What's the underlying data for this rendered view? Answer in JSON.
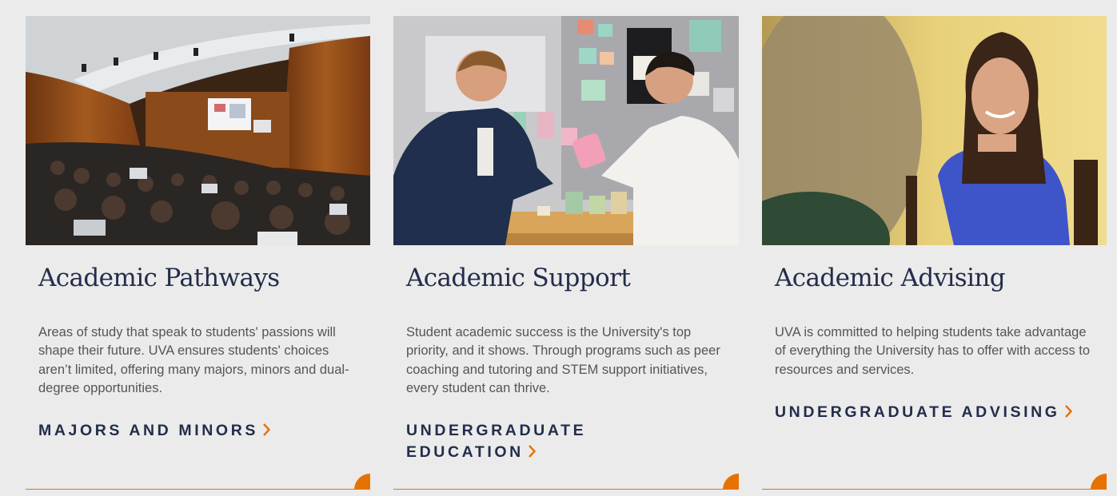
{
  "cards": [
    {
      "title": "Academic Pathways",
      "description": "Areas of study that speak to students' passions will shape their future. UVA ensures students' choices aren’t limited, offering many majors, minors and dual-degree opportunities.",
      "link_label": "MAJORS AND MINORS"
    },
    {
      "title": "Academic Support",
      "description": "Student academic success is the University's top priority, and it shows. Through programs such as peer coaching and tutoring and STEM support initiatives, every student can thrive.",
      "link_label": "UNDERGRADUATE EDUCATION"
    },
    {
      "title": "Academic Advising",
      "description": "UVA is committed to helping students take advantage of everything the University has to offer with access to resources and services.",
      "link_label": "UNDERGRADUATE ADVISING"
    }
  ],
  "colors": {
    "navy": "#232d4b",
    "orange": "#e57200",
    "body_text": "#555555",
    "background": "#ebebeb"
  },
  "icons": {
    "link_arrow": "chevron-right-icon",
    "card_corner": "quarter-circle-corner"
  }
}
